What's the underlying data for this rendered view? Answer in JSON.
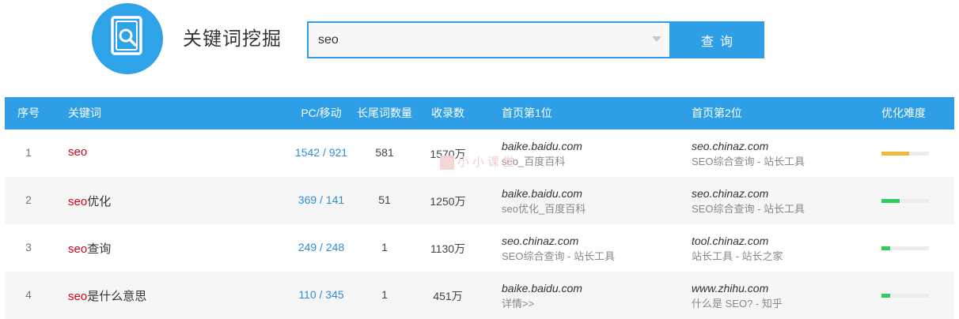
{
  "page": {
    "title": "关键词挖掘"
  },
  "search": {
    "value": "seo",
    "button_label": "查询"
  },
  "table": {
    "headers": {
      "index": "序号",
      "keyword": "关键词",
      "pc_mobile": "PC/移动",
      "long_tail": "长尾词数量",
      "indexed": "收录数",
      "first": "首页第1位",
      "second": "首页第2位",
      "difficulty": "优化难度"
    },
    "rows": [
      {
        "index": "1",
        "kw_highlight": "seo",
        "kw_rest": "",
        "pc_mobile": "1542 / 921",
        "long_tail": "581",
        "indexed": "1570万",
        "first_domain": "baike.baidu.com",
        "first_title": "seo_百度百科",
        "second_domain": "seo.chinaz.com",
        "second_title": "SEO综合查询 - 站长工具",
        "difficulty": 0.58,
        "difficulty_color": "#f0b93a"
      },
      {
        "index": "2",
        "kw_highlight": "seo",
        "kw_rest": "优化",
        "pc_mobile": "369 / 141",
        "long_tail": "51",
        "indexed": "1250万",
        "first_domain": "baike.baidu.com",
        "first_title": "seo优化_百度百科",
        "second_domain": "seo.chinaz.com",
        "second_title": "SEO综合查询 - 站长工具",
        "difficulty": 0.38,
        "difficulty_color": "#2ecc5a"
      },
      {
        "index": "3",
        "kw_highlight": "seo",
        "kw_rest": "查询",
        "pc_mobile": "249 / 248",
        "long_tail": "1",
        "indexed": "1130万",
        "first_domain": "seo.chinaz.com",
        "first_title": "SEO综合查询 - 站长工具",
        "second_domain": "tool.chinaz.com",
        "second_title": "站长工具 - 站长之家",
        "difficulty": 0.18,
        "difficulty_color": "#2ecc5a"
      },
      {
        "index": "4",
        "kw_highlight": "seo",
        "kw_rest": "是什么意思",
        "pc_mobile": "110 / 345",
        "long_tail": "1",
        "indexed": "451万",
        "first_domain": "baike.baidu.com",
        "first_title": "详情>>",
        "second_domain": "www.zhihu.com",
        "second_title": "什么是 SEO? - 知乎",
        "difficulty": 0.18,
        "difficulty_color": "#2ecc5a"
      }
    ]
  },
  "watermark": {
    "text": "小小课堂"
  },
  "colors": {
    "accent": "#2e9fe6",
    "keyword_highlight": "#d0021b",
    "link": "#2e8ed4"
  }
}
